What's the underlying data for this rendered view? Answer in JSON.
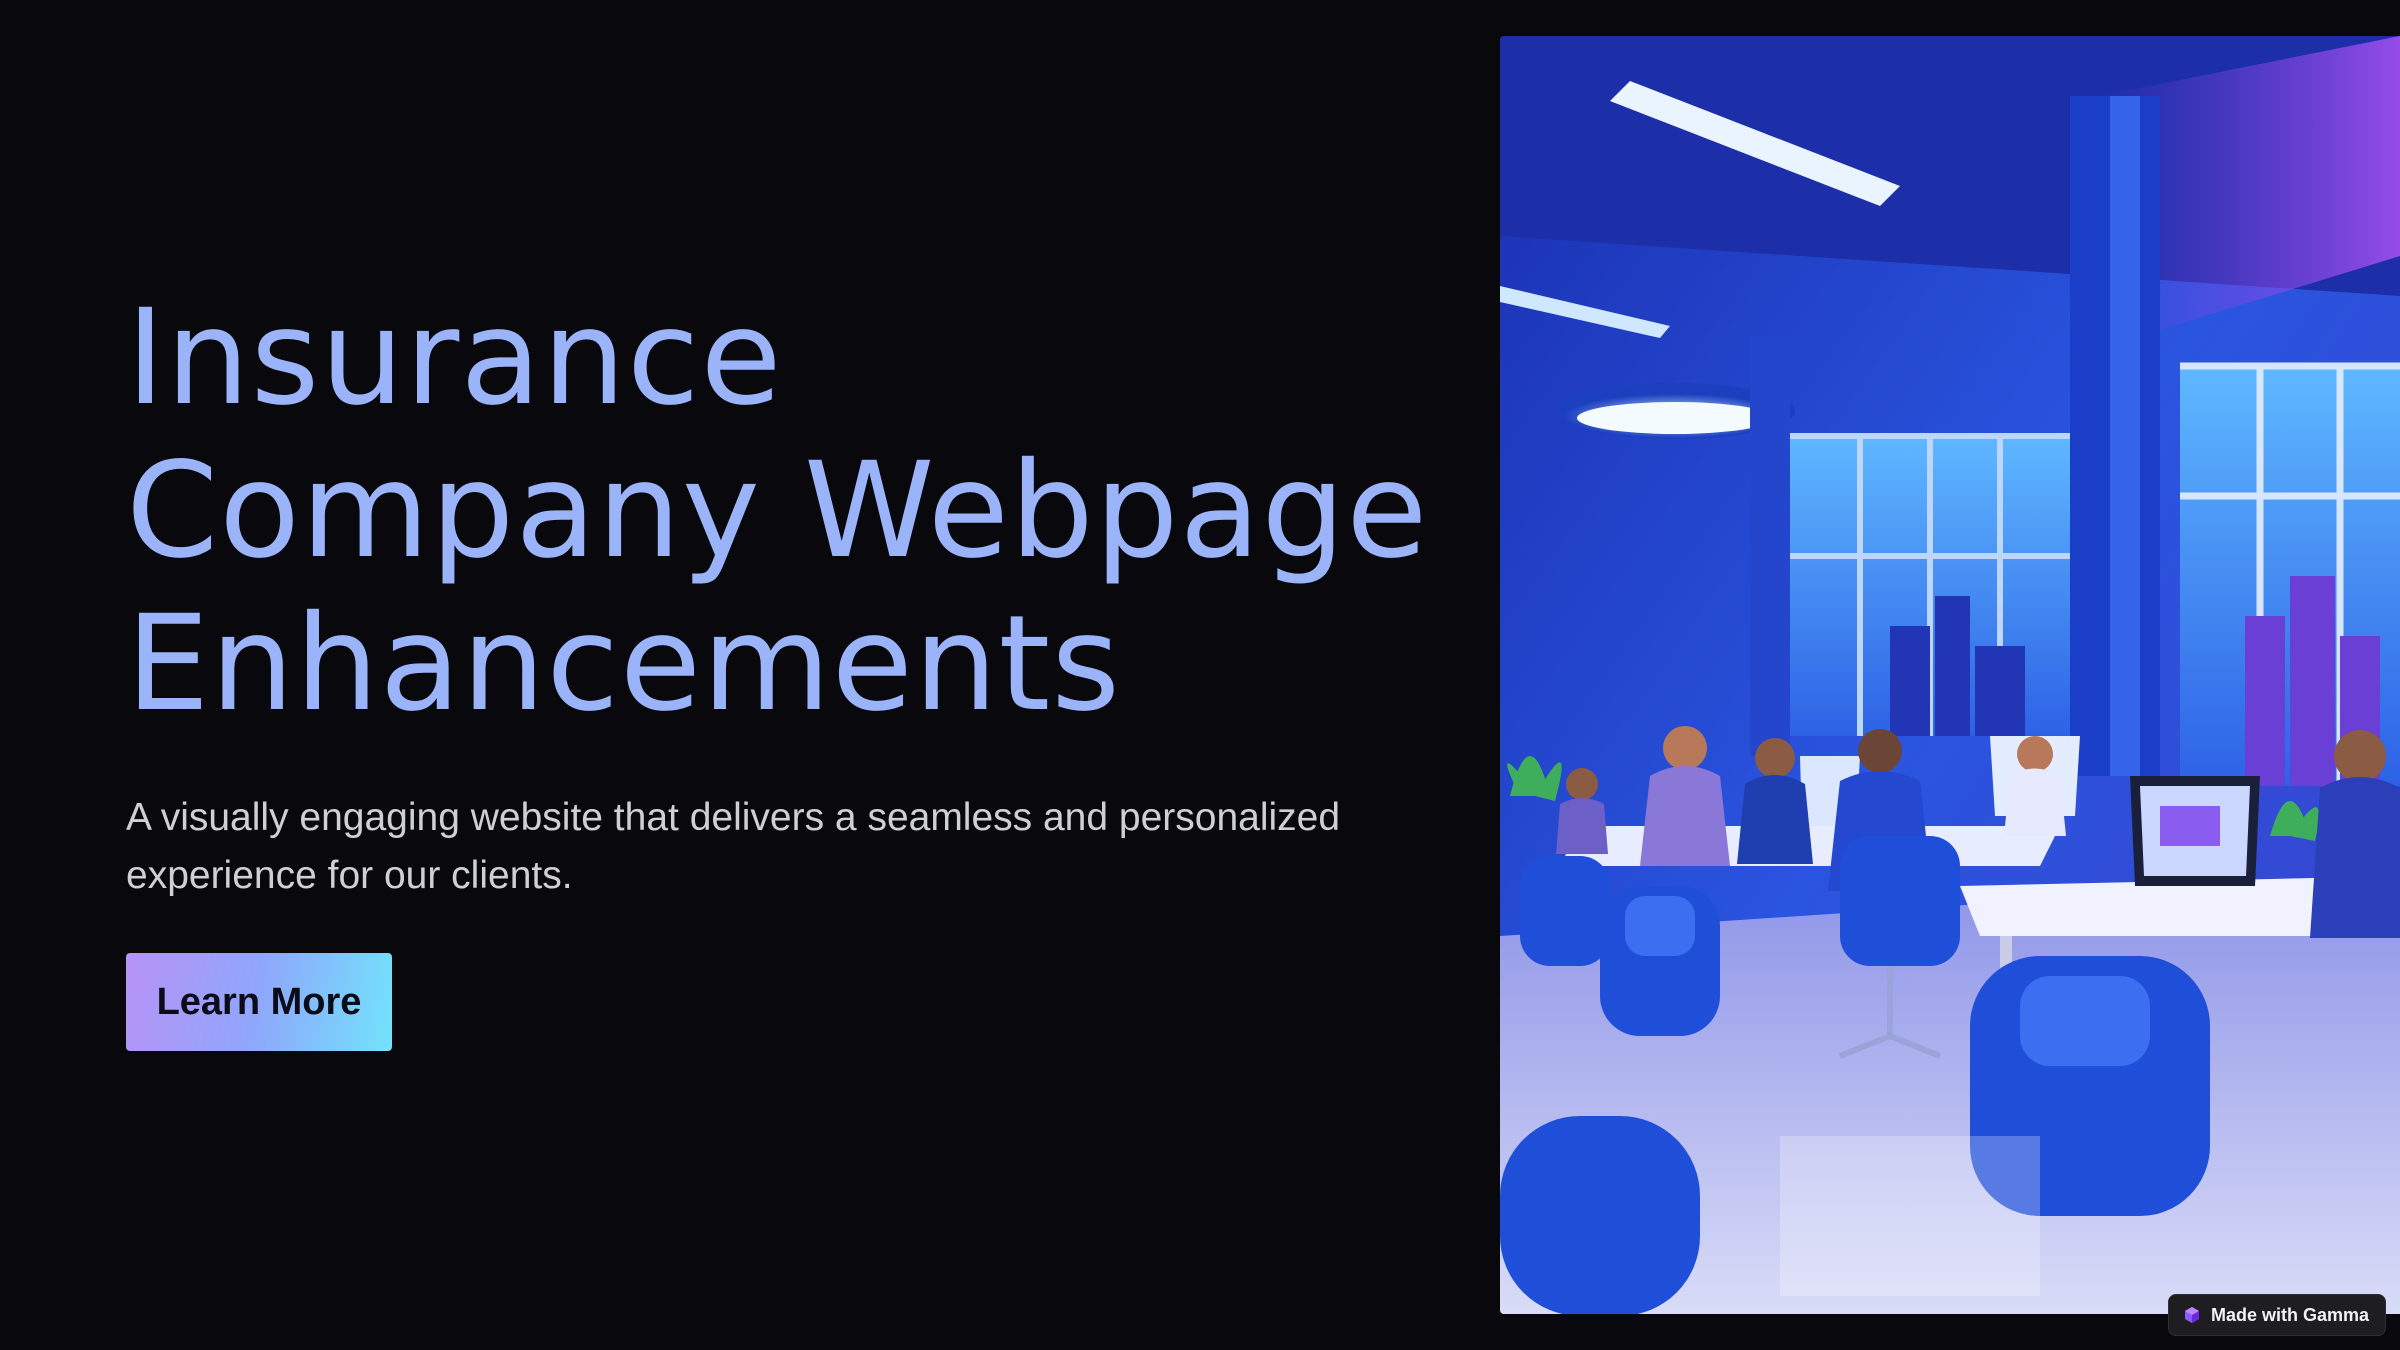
{
  "slide": {
    "title_lines": [
      "Insurance",
      "Company Webpage",
      "Enhancements"
    ],
    "subtitle": "A visually engaging website that delivers a seamless and personalized experience for our clients.",
    "cta_label": "Learn More"
  },
  "hero_image": {
    "alt": "Illustration of a modern blue office with people working at laptops"
  },
  "badge": {
    "label": "Made with Gamma",
    "icon": "gamma-logo-icon"
  },
  "colors": {
    "background": "#08080d",
    "title": "#9bb3f8",
    "button_gradient_start": "#b793f6",
    "button_gradient_end": "#72e3fb"
  }
}
